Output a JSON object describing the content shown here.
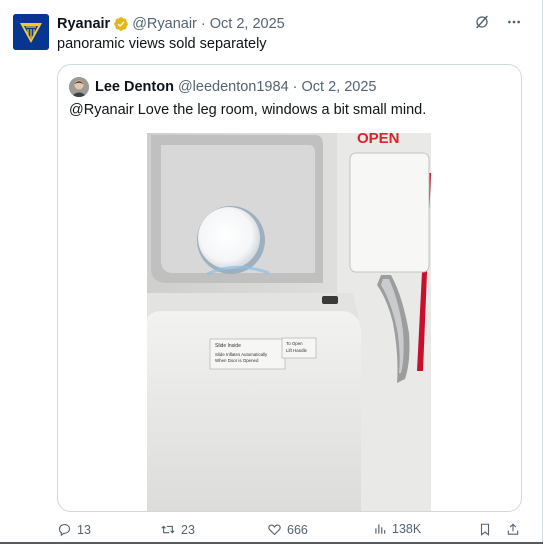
{
  "tweet": {
    "author_name": "Ryanair",
    "handle": "@Ryanair",
    "separator": "·",
    "date": "Oct 2, 2025",
    "text": "panoramic views sold separately",
    "avatar_icon": "ryanair-harp-logo"
  },
  "quote": {
    "author_name": "Lee Denton",
    "handle": "@leedenton1984",
    "separator": "·",
    "date": "Oct 2, 2025",
    "text": "@Ryanair Love the leg room, windows a bit small mind.",
    "media": {
      "sign_top": "OPEN",
      "placard_left_line1": "Slide Inside",
      "placard_left_line2": "Slide Inflates Automatically",
      "placard_left_line3": "When Door is Opened",
      "placard_right_line1": "To Open",
      "placard_right_line2": "Lift Handle"
    }
  },
  "actions": {
    "replies": "13",
    "reposts": "23",
    "likes": "666",
    "views": "138K"
  },
  "colors": {
    "text": "#0f1419",
    "secondary": "#536471",
    "border": "#cfd9de",
    "verified_gold": "#e2b719",
    "ryanair_blue": "#073590",
    "ryanair_yellow": "#f1c933"
  }
}
